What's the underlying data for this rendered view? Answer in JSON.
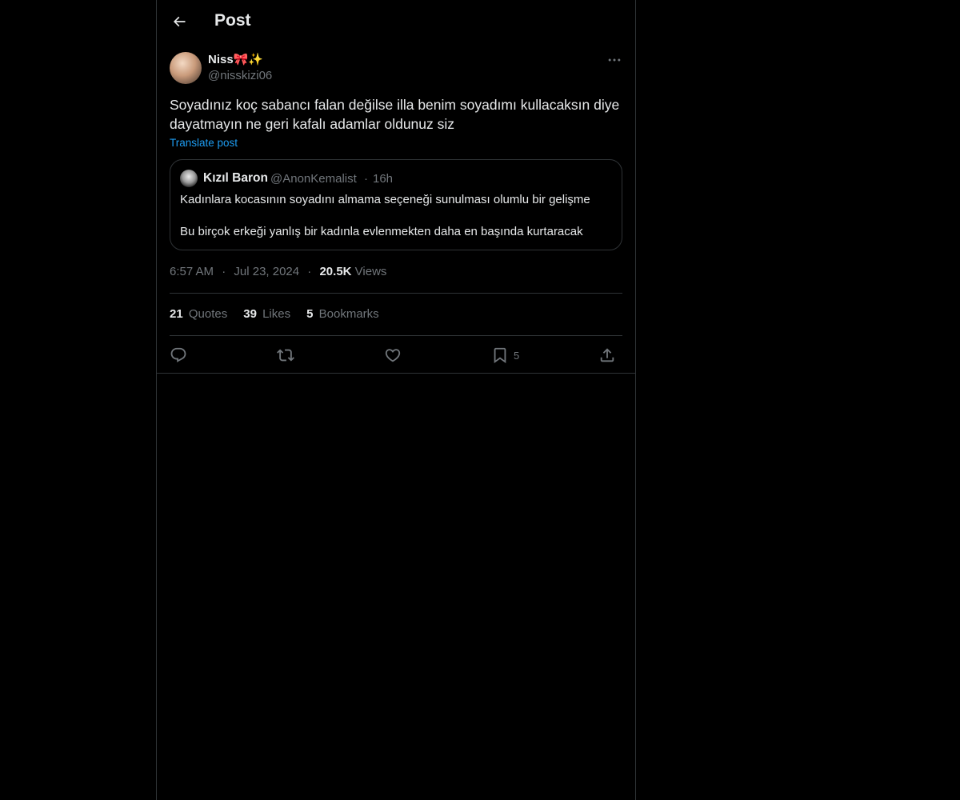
{
  "header": {
    "title": "Post",
    "back_icon": "arrow-left-icon"
  },
  "post": {
    "author": {
      "name": "Niss🎀✨",
      "handle": "@nisskizi06"
    },
    "text": "Soyadınız koç sabancı falan değilse illa benim soyadımı kullacaksın diye dayatmayın ne geri kafalı adamlar oldunuz siz",
    "translate_label": "Translate post",
    "time": "6:57 AM",
    "date": "Jul 23, 2024",
    "separator": "·",
    "views_count": "20.5K",
    "views_label": "Views"
  },
  "quote": {
    "name": "Kızıl Baron",
    "handle": "@AnonKemalist",
    "separator": "·",
    "time": "16h",
    "line1": "Kadınlara kocasının soyadını almama seçeneği sunulması olumlu bir gelişme",
    "line2": "Bu birçok erkeği yanlış bir kadınla evlenmekten daha en başında kurtaracak"
  },
  "stats": {
    "quotes_count": "21",
    "quotes_label": "Quotes",
    "likes_count": "39",
    "likes_label": "Likes",
    "bookmarks_count": "5",
    "bookmarks_label": "Bookmarks"
  },
  "actions": {
    "reply_icon": "reply-icon",
    "repost_icon": "repost-icon",
    "like_icon": "heart-icon",
    "bookmark_icon": "bookmark-icon",
    "bookmark_count": "5",
    "share_icon": "share-icon"
  },
  "colors": {
    "background": "#000000",
    "text_primary": "#e7e9ea",
    "text_secondary": "#71767b",
    "link": "#1d9bf0",
    "border": "#2f3336"
  }
}
